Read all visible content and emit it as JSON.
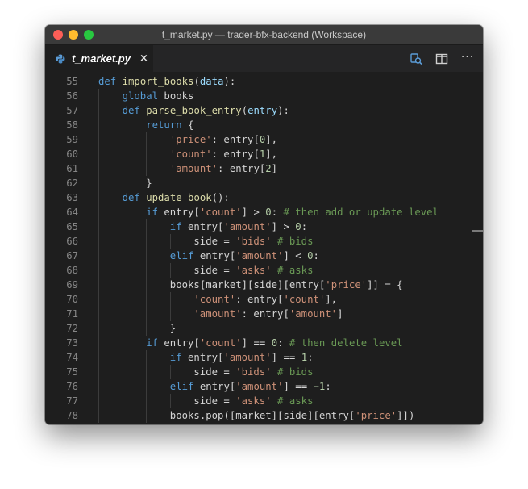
{
  "window": {
    "title": "t_market.py — trader-bfx-backend (Workspace)"
  },
  "tab": {
    "label": "t_market.py",
    "close_glyph": "×",
    "icon": "python-icon"
  },
  "toolbar": {
    "icons": [
      "open-changes-icon",
      "split-editor-icon",
      "more-actions-icon"
    ],
    "more_glyph": "···"
  },
  "editor": {
    "language": "python",
    "lines": [
      {
        "n": "55",
        "indent": 0,
        "tokens": [
          [
            "kw",
            "def "
          ],
          [
            "fn",
            "import_books"
          ],
          [
            "p",
            "("
          ],
          [
            "vr",
            "data"
          ],
          [
            "p",
            "):"
          ]
        ]
      },
      {
        "n": "56",
        "indent": 1,
        "tokens": [
          [
            "kw",
            "global "
          ],
          [
            "p",
            "books"
          ]
        ]
      },
      {
        "n": "57",
        "indent": 1,
        "tokens": [
          [
            "kw",
            "def "
          ],
          [
            "fn",
            "parse_book_entry"
          ],
          [
            "p",
            "("
          ],
          [
            "vr",
            "entry"
          ],
          [
            "p",
            "):"
          ]
        ]
      },
      {
        "n": "58",
        "indent": 2,
        "tokens": [
          [
            "kw",
            "return "
          ],
          [
            "p",
            "{"
          ]
        ]
      },
      {
        "n": "59",
        "indent": 3,
        "tokens": [
          [
            "st",
            "'price'"
          ],
          [
            "p",
            ": entry["
          ],
          [
            "nm",
            "0"
          ],
          [
            "p",
            "],"
          ]
        ]
      },
      {
        "n": "60",
        "indent": 3,
        "tokens": [
          [
            "st",
            "'count'"
          ],
          [
            "p",
            ": entry["
          ],
          [
            "nm",
            "1"
          ],
          [
            "p",
            "],"
          ]
        ]
      },
      {
        "n": "61",
        "indent": 3,
        "tokens": [
          [
            "st",
            "'amount'"
          ],
          [
            "p",
            ": entry["
          ],
          [
            "nm",
            "2"
          ],
          [
            "p",
            "]"
          ]
        ]
      },
      {
        "n": "62",
        "indent": 2,
        "tokens": [
          [
            "p",
            "}"
          ]
        ]
      },
      {
        "n": "63",
        "indent": 1,
        "tokens": [
          [
            "kw",
            "def "
          ],
          [
            "fn",
            "update_book"
          ],
          [
            "p",
            "():"
          ]
        ]
      },
      {
        "n": "64",
        "indent": 2,
        "tokens": [
          [
            "kw",
            "if "
          ],
          [
            "p",
            "entry["
          ],
          [
            "st",
            "'count'"
          ],
          [
            "p",
            "] > "
          ],
          [
            "nm",
            "0"
          ],
          [
            "p",
            ": "
          ],
          [
            "cm",
            "# then add or update level"
          ]
        ]
      },
      {
        "n": "65",
        "indent": 3,
        "tokens": [
          [
            "kw",
            "if "
          ],
          [
            "p",
            "entry["
          ],
          [
            "st",
            "'amount'"
          ],
          [
            "p",
            "] > "
          ],
          [
            "nm",
            "0"
          ],
          [
            "p",
            ":"
          ]
        ]
      },
      {
        "n": "66",
        "indent": 4,
        "tokens": [
          [
            "p",
            "side = "
          ],
          [
            "st",
            "'bids'"
          ],
          [
            "p",
            " "
          ],
          [
            "cm",
            "# bids"
          ]
        ]
      },
      {
        "n": "67",
        "indent": 3,
        "tokens": [
          [
            "kw",
            "elif "
          ],
          [
            "p",
            "entry["
          ],
          [
            "st",
            "'amount'"
          ],
          [
            "p",
            "] < "
          ],
          [
            "nm",
            "0"
          ],
          [
            "p",
            ":"
          ]
        ]
      },
      {
        "n": "68",
        "indent": 4,
        "tokens": [
          [
            "p",
            "side = "
          ],
          [
            "st",
            "'asks'"
          ],
          [
            "p",
            " "
          ],
          [
            "cm",
            "# asks"
          ]
        ]
      },
      {
        "n": "69",
        "indent": 3,
        "tokens": [
          [
            "p",
            "books[market][side][entry["
          ],
          [
            "st",
            "'price'"
          ],
          [
            "p",
            "]] = {"
          ]
        ]
      },
      {
        "n": "70",
        "indent": 4,
        "tokens": [
          [
            "st",
            "'count'"
          ],
          [
            "p",
            ": entry["
          ],
          [
            "st",
            "'count'"
          ],
          [
            "p",
            "],"
          ]
        ]
      },
      {
        "n": "71",
        "indent": 4,
        "tokens": [
          [
            "st",
            "'amount'"
          ],
          [
            "p",
            ": entry["
          ],
          [
            "st",
            "'amount'"
          ],
          [
            "p",
            "]"
          ]
        ]
      },
      {
        "n": "72",
        "indent": 3,
        "tokens": [
          [
            "p",
            "}"
          ]
        ]
      },
      {
        "n": "73",
        "indent": 2,
        "tokens": [
          [
            "kw",
            "if "
          ],
          [
            "p",
            "entry["
          ],
          [
            "st",
            "'count'"
          ],
          [
            "p",
            "] == "
          ],
          [
            "nm",
            "0"
          ],
          [
            "p",
            ": "
          ],
          [
            "cm",
            "# then delete level"
          ]
        ]
      },
      {
        "n": "74",
        "indent": 3,
        "tokens": [
          [
            "kw",
            "if "
          ],
          [
            "p",
            "entry["
          ],
          [
            "st",
            "'amount'"
          ],
          [
            "p",
            "] == "
          ],
          [
            "nm",
            "1"
          ],
          [
            "p",
            ":"
          ]
        ]
      },
      {
        "n": "75",
        "indent": 4,
        "tokens": [
          [
            "p",
            "side = "
          ],
          [
            "st",
            "'bids'"
          ],
          [
            "p",
            " "
          ],
          [
            "cm",
            "# bids"
          ]
        ]
      },
      {
        "n": "76",
        "indent": 3,
        "tokens": [
          [
            "kw",
            "elif "
          ],
          [
            "p",
            "entry["
          ],
          [
            "st",
            "'amount'"
          ],
          [
            "p",
            "] == "
          ],
          [
            "nm",
            "−1"
          ],
          [
            "p",
            ":"
          ]
        ]
      },
      {
        "n": "77",
        "indent": 4,
        "tokens": [
          [
            "p",
            "side = "
          ],
          [
            "st",
            "'asks'"
          ],
          [
            "p",
            " "
          ],
          [
            "cm",
            "# asks"
          ]
        ]
      },
      {
        "n": "78",
        "indent": 3,
        "tokens": [
          [
            "p",
            "books.pop([market][side][entry["
          ],
          [
            "st",
            "'price'"
          ],
          [
            "p",
            "]])"
          ]
        ]
      }
    ]
  },
  "colors": {
    "background": "#1e1e1e",
    "keyword": "#569cd6",
    "function": "#dcdcaa",
    "string": "#ce9178",
    "comment": "#6a9955",
    "number": "#b5cea8",
    "parameter": "#9cdcfe",
    "default": "#d4d4d4"
  }
}
